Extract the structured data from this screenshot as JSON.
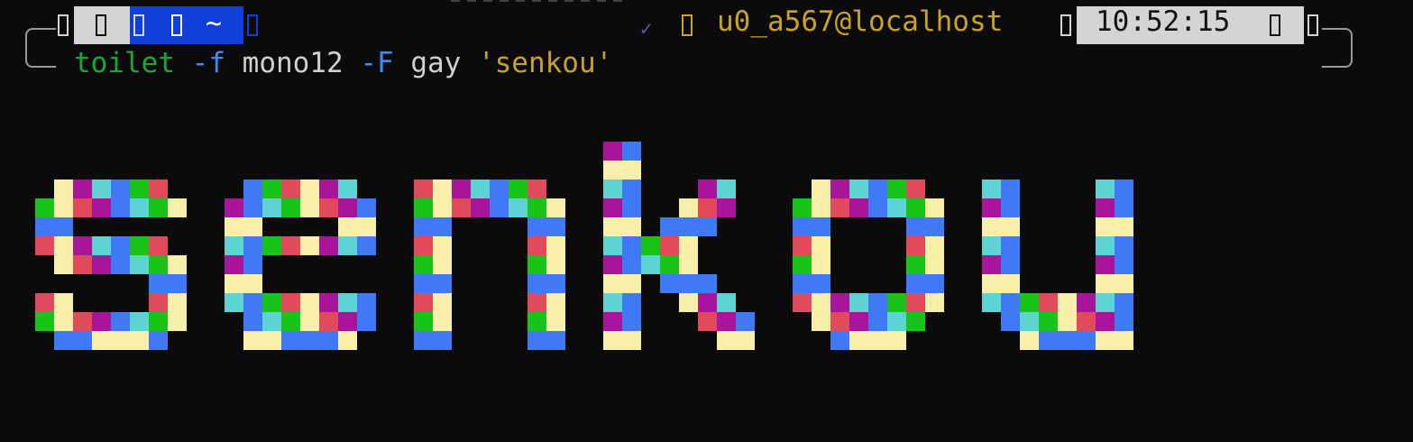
{
  "prompt": {
    "dir": "~",
    "user_host": "u0_a567@localhost",
    "time": "10:52:15",
    "check_icon": "✓"
  },
  "command": {
    "program": "toilet",
    "flag_font": "-f",
    "font": "mono12",
    "flag_filter": "-F",
    "filter": "gay",
    "argument": "'senkou'"
  },
  "output": {
    "text": "senkou",
    "palette": [
      "#17c417",
      "#5ed3d3",
      "#3f79f5",
      "#a8159a",
      "#e04a5a",
      "#f8f0a8"
    ]
  },
  "colors": {
    "background": "#0b0b0b",
    "prompt_blue": "#0f3fd6",
    "prompt_grey": "#d4d4d4",
    "user_host": "#c9a228",
    "cmd_green": "#18a83a",
    "cmd_blue": "#3f8bf5"
  }
}
